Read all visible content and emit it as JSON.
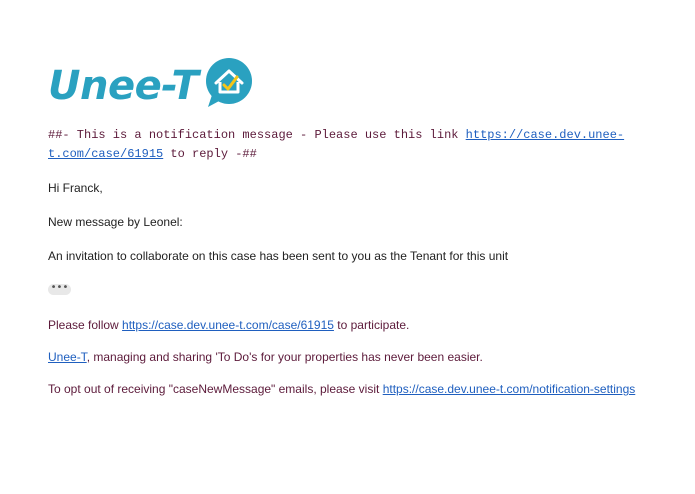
{
  "logo": {
    "brand_text": "Unee-T",
    "icon": "house-check-chat-icon",
    "brand_color": "#2aa1c0"
  },
  "notice": {
    "prefix": "##- This is a notification message - Please use this link ",
    "link_text": "https://case.dev.unee-t.com/case/61915",
    "suffix": " to reply -##"
  },
  "greeting": "Hi Franck,",
  "by_line": "New message by Leonel:",
  "invitation": "An invitation to collaborate on this case has been sent to you as the Tenant for this unit",
  "ellipsis": "•••",
  "follow": {
    "prefix": "Please follow ",
    "link_text": "https://case.dev.unee-t.com/case/61915",
    "suffix": " to participate."
  },
  "tagline": {
    "link_text": "Unee-T",
    "suffix": ", managing and sharing 'To Do's for your properties has never been easier."
  },
  "optout": {
    "prefix": "To opt out of receiving \"caseNewMessage\" emails, please visit ",
    "link_text": "https://case.dev.unee-t.com/notification-settings"
  },
  "colors": {
    "link": "#1f5fbf",
    "footer_text": "#5c1a3a",
    "body_text": "#222222"
  }
}
